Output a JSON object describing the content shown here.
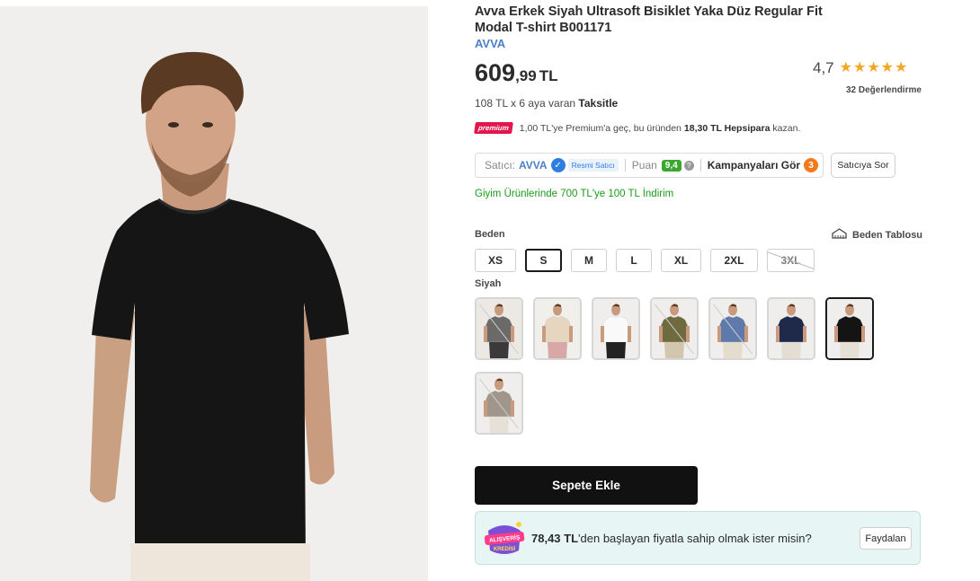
{
  "product": {
    "title_line1": "Avva Erkek Siyah Ultrasoft Bisiklet Yaka Düz Regular Fit",
    "title_line2": "Modal T-shirt B001171",
    "brand": "AVVA"
  },
  "price": {
    "main": "609",
    "decimals": ",99",
    "currency": "TL"
  },
  "rating": {
    "score": "4,7",
    "stars": 5,
    "reviews_label": "32 Değerlendirme"
  },
  "installment": {
    "text": "108 TL x 6 aya varan",
    "highlight": "Taksitle"
  },
  "premium": {
    "badge": "premium",
    "text_before": "1,00 TL'ye Premium'a geç, bu üründen",
    "amount": "18,30 TL Hepsipara",
    "text_after": "kazan."
  },
  "seller": {
    "label": "Satıcı:",
    "name": "AVVA",
    "official_label": "Resmi Satıcı",
    "score_label": "Puan",
    "score": "9,4",
    "campaigns_label": "Kampanyaları Gör",
    "campaigns_count": "3",
    "ask_button": "Satıcıya Sor"
  },
  "promo": "Giyim Ürünlerinde 700 TL'ye 100 TL İndirim",
  "sizes": {
    "label": "Beden",
    "table_label": "Beden Tablosu",
    "options": [
      {
        "label": "XS",
        "state": "normal"
      },
      {
        "label": "S",
        "state": "selected"
      },
      {
        "label": "M",
        "state": "normal"
      },
      {
        "label": "L",
        "state": "normal"
      },
      {
        "label": "XL",
        "state": "normal"
      },
      {
        "label": "2XL",
        "state": "normal"
      },
      {
        "label": "3XL",
        "state": "disabled"
      }
    ]
  },
  "colors": {
    "label": "Siyah",
    "options": [
      {
        "name": "antrasit",
        "shirt": "#6b6a68",
        "pants": "#3a3a3a",
        "bg": "#ece9e4",
        "state": "unavailable"
      },
      {
        "name": "bej",
        "shirt": "#e6d6bf",
        "pants": "#d7a8a6",
        "bg": "#f1efeb",
        "state": "normal"
      },
      {
        "name": "beyaz",
        "shirt": "#f9f9f9",
        "pants": "#222222",
        "bg": "#efeeec",
        "state": "normal"
      },
      {
        "name": "haki",
        "shirt": "#6e6b3e",
        "pants": "#d3c6ae",
        "bg": "#efeeec",
        "state": "unavailable"
      },
      {
        "name": "indigo",
        "shirt": "#5e7aab",
        "pants": "#e4dccd",
        "bg": "#efeeec",
        "state": "unavailable"
      },
      {
        "name": "lacivert",
        "shirt": "#1f2a4b",
        "pants": "#e3ddd2",
        "bg": "#efeeec",
        "state": "normal"
      },
      {
        "name": "siyah",
        "shirt": "#141414",
        "pants": "#e6dfd4",
        "bg": "#efeeec",
        "state": "selected"
      },
      {
        "name": "vizon",
        "shirt": "#a1968b",
        "pants": "#e7e0d6",
        "bg": "#efeeec",
        "state": "unavailable"
      }
    ]
  },
  "cart": {
    "add_button": "Sepete Ekle"
  },
  "credit": {
    "logo_text_1": "ALIŞVERİŞ",
    "logo_text_2": "KREDİSİ",
    "amount": "78,43 TL",
    "text": "'den başlayan fiyatla sahip olmak ister misin?",
    "button": "Faydalan"
  },
  "theme": {
    "brand_blue": "#4c7fc7",
    "star_color": "#f5a623",
    "promo_green": "#1a9b1a",
    "premium_pink": "#e3154e",
    "campaign_orange": "#f27a1a"
  }
}
